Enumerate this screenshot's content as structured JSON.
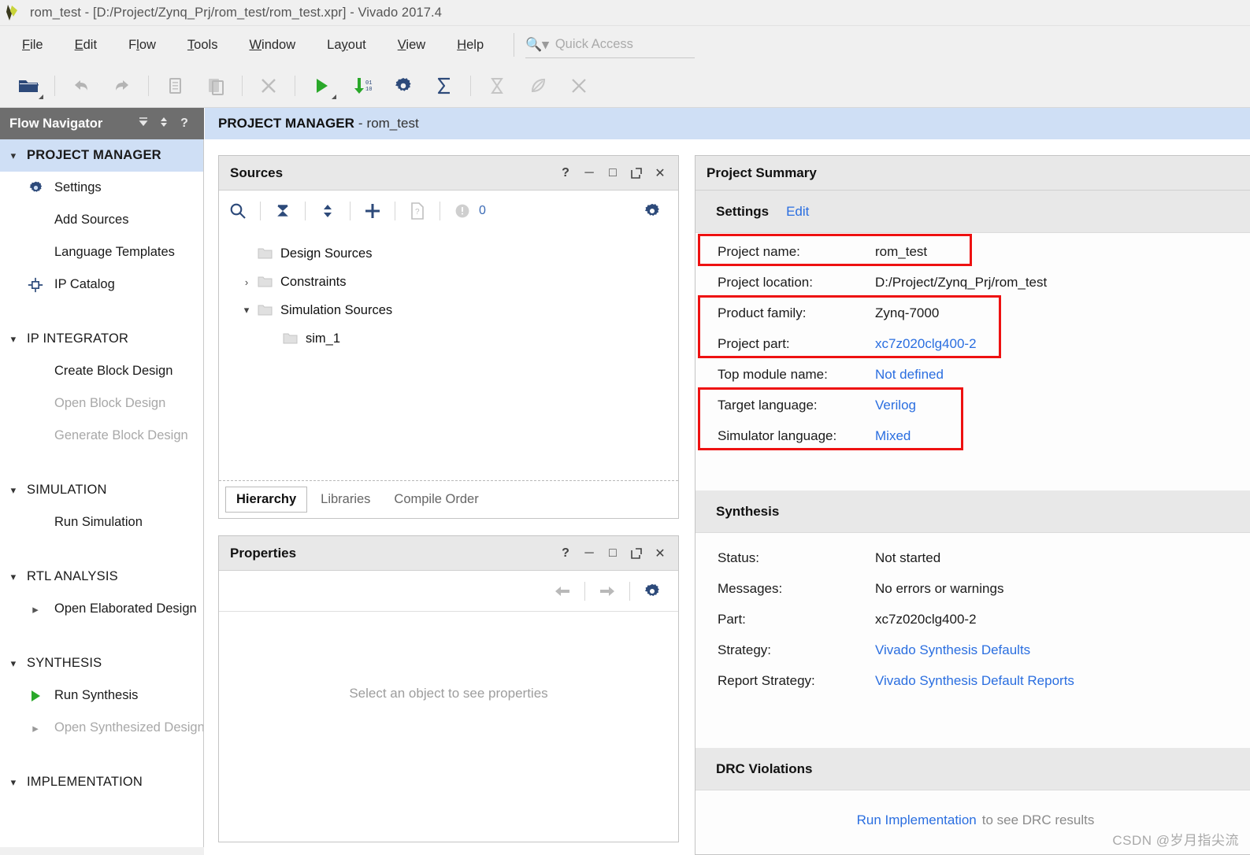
{
  "window": {
    "title": "rom_test - [D:/Project/Zynq_Prj/rom_test/rom_test.xpr] - Vivado 2017.4",
    "logo_icon": "vivado-logo-icon"
  },
  "menubar": {
    "items": [
      {
        "label": "File",
        "mnemonic": "F"
      },
      {
        "label": "Edit",
        "mnemonic": "E"
      },
      {
        "label": "Flow",
        "mnemonic": "l"
      },
      {
        "label": "Tools",
        "mnemonic": "T"
      },
      {
        "label": "Window",
        "mnemonic": "W"
      },
      {
        "label": "Layout",
        "mnemonic": "y"
      },
      {
        "label": "View",
        "mnemonic": "V"
      },
      {
        "label": "Help",
        "mnemonic": "H"
      }
    ],
    "quick_access": {
      "placeholder": "Quick Access",
      "icon": "search-dropdown-icon",
      "value": ""
    }
  },
  "toolbar": {
    "buttons": [
      {
        "name": "open-project-button",
        "icon": "open-folder-icon",
        "enabled": true,
        "dropdown": true
      },
      {
        "name": "undo-button",
        "icon": "undo-arrow-icon",
        "enabled": false
      },
      {
        "name": "redo-button",
        "icon": "redo-arrow-icon",
        "enabled": false
      },
      {
        "name": "copy-button",
        "icon": "copy-icon",
        "enabled": false
      },
      {
        "name": "paste-button",
        "icon": "paste-icon",
        "enabled": false
      },
      {
        "name": "delete-button",
        "icon": "close-x-icon",
        "enabled": false
      },
      {
        "name": "run-button",
        "icon": "green-play-icon",
        "enabled": true,
        "dropdown": true
      },
      {
        "name": "generate-bitstream-button",
        "icon": "binary-download-icon",
        "enabled": true
      },
      {
        "name": "settings-button",
        "icon": "gear-icon",
        "enabled": true
      },
      {
        "name": "report-button",
        "icon": "sigma-icon",
        "enabled": true
      },
      {
        "name": "timing-button",
        "icon": "hourglass-icon",
        "enabled": false
      },
      {
        "name": "power-button",
        "icon": "leaf-icon",
        "enabled": false
      },
      {
        "name": "drc-button",
        "icon": "cross-icon",
        "enabled": false
      }
    ]
  },
  "flow_navigator": {
    "header": {
      "title": "Flow Navigator",
      "icons": [
        "collapse-all-icon",
        "expand-collapse-icon",
        "help-icon"
      ]
    },
    "sections": [
      {
        "name": "project-manager",
        "label": "PROJECT MANAGER",
        "expanded": true,
        "active": true,
        "items": [
          {
            "label": "Settings",
            "icon": "gear-icon",
            "enabled": true
          },
          {
            "label": "Add Sources",
            "icon": null,
            "enabled": true
          },
          {
            "label": "Language Templates",
            "icon": null,
            "enabled": true
          },
          {
            "label": "IP Catalog",
            "icon": "ip-chip-icon",
            "enabled": true
          }
        ]
      },
      {
        "name": "ip-integrator",
        "label": "IP INTEGRATOR",
        "expanded": true,
        "active": false,
        "items": [
          {
            "label": "Create Block Design",
            "icon": null,
            "enabled": true
          },
          {
            "label": "Open Block Design",
            "icon": null,
            "enabled": false
          },
          {
            "label": "Generate Block Design",
            "icon": null,
            "enabled": false
          }
        ]
      },
      {
        "name": "simulation",
        "label": "SIMULATION",
        "expanded": true,
        "active": false,
        "items": [
          {
            "label": "Run Simulation",
            "icon": null,
            "enabled": true
          }
        ]
      },
      {
        "name": "rtl-analysis",
        "label": "RTL ANALYSIS",
        "expanded": true,
        "active": false,
        "items": [
          {
            "label": "Open Elaborated Design",
            "icon": "chevron-right-icon",
            "enabled": true
          }
        ]
      },
      {
        "name": "synthesis",
        "label": "SYNTHESIS",
        "expanded": true,
        "active": false,
        "items": [
          {
            "label": "Run Synthesis",
            "icon": "green-play-icon",
            "enabled": true
          },
          {
            "label": "Open Synthesized Design",
            "icon": "chevron-right-icon",
            "enabled": false
          }
        ]
      },
      {
        "name": "implementation",
        "label": "IMPLEMENTATION",
        "expanded": true,
        "active": false,
        "items": []
      }
    ]
  },
  "main": {
    "header": {
      "title": "PROJECT MANAGER",
      "separator": "-",
      "project": "rom_test"
    }
  },
  "sources_panel": {
    "title": "Sources",
    "window_controls": [
      "help-icon",
      "minimize-icon",
      "maximize-icon",
      "float-icon",
      "close-icon"
    ],
    "toolbar": [
      {
        "name": "search-button",
        "icon": "search-icon"
      },
      {
        "name": "collapse-all-button",
        "icon": "collapse-all-icon"
      },
      {
        "name": "expand-all-button",
        "icon": "expand-all-icon"
      },
      {
        "name": "add-sources-button",
        "icon": "plus-icon"
      },
      {
        "name": "file-info-button",
        "icon": "file-question-icon"
      },
      {
        "name": "status-indicator",
        "icon": "circle-warning-icon"
      }
    ],
    "status_count": "0",
    "settings_icon": "gear-icon",
    "tree": [
      {
        "label": "Design Sources",
        "arrow": "none",
        "indent": 1,
        "icon": "folder-icon"
      },
      {
        "label": "Constraints",
        "arrow": "collapsed",
        "indent": 0,
        "icon": "folder-icon"
      },
      {
        "label": "Simulation Sources",
        "arrow": "expanded",
        "indent": 0,
        "icon": "folder-icon"
      },
      {
        "label": "sim_1",
        "arrow": "none",
        "indent": 2,
        "icon": "folder-icon"
      }
    ],
    "tabs": [
      {
        "label": "Hierarchy",
        "active": true
      },
      {
        "label": "Libraries",
        "active": false
      },
      {
        "label": "Compile Order",
        "active": false
      }
    ]
  },
  "properties_panel": {
    "title": "Properties",
    "window_controls": [
      "help-icon",
      "minimize-icon",
      "maximize-icon",
      "float-icon",
      "close-icon"
    ],
    "toolbar": [
      {
        "name": "back-button",
        "icon": "left-arrow-icon"
      },
      {
        "name": "forward-button",
        "icon": "right-arrow-icon"
      },
      {
        "name": "settings-button",
        "icon": "gear-icon"
      }
    ],
    "empty_message": "Select an object to see properties"
  },
  "project_summary": {
    "title": "Project Summary",
    "settings_section": {
      "label": "Settings",
      "edit_link": "Edit",
      "rows": [
        {
          "key": "Project name:",
          "value": "rom_test",
          "link": false,
          "highlighted": true
        },
        {
          "key": "Project location:",
          "value": "D:/Project/Zynq_Prj/rom_test",
          "link": false,
          "highlighted": false
        },
        {
          "key": "Product family:",
          "value": "Zynq-7000",
          "link": false,
          "highlighted": true
        },
        {
          "key": "Project part:",
          "value": "xc7z020clg400-2",
          "link": true,
          "highlighted": true
        },
        {
          "key": "Top module name:",
          "value": "Not defined",
          "link": true,
          "highlighted": false
        },
        {
          "key": "Target language:",
          "value": "Verilog",
          "link": true,
          "highlighted": true
        },
        {
          "key": "Simulator language:",
          "value": "Mixed",
          "link": true,
          "highlighted": true
        }
      ]
    },
    "synthesis_section": {
      "label": "Synthesis",
      "rows": [
        {
          "key": "Status:",
          "value": "Not started",
          "link": false
        },
        {
          "key": "Messages:",
          "value": "No errors or warnings",
          "link": false
        },
        {
          "key": "Part:",
          "value": "xc7z020clg400-2",
          "link": false
        },
        {
          "key": "Strategy:",
          "value": "Vivado Synthesis Defaults",
          "link": true
        },
        {
          "key": "Report Strategy:",
          "value": "Vivado Synthesis Default Reports",
          "link": true
        }
      ]
    },
    "drc_section": {
      "label": "DRC Violations",
      "link_text": "Run Implementation",
      "rest_text": "to see DRC results"
    }
  },
  "watermark": "CSDN @岁月指尖流",
  "colors": {
    "accent_blue": "#2a6ee0",
    "highlight_red": "#ee1111",
    "nav_header_gray": "#6e6e6e",
    "active_row_blue": "#cfdff5",
    "icon_navy": "#2d4a7a",
    "green": "#2aa82a"
  }
}
